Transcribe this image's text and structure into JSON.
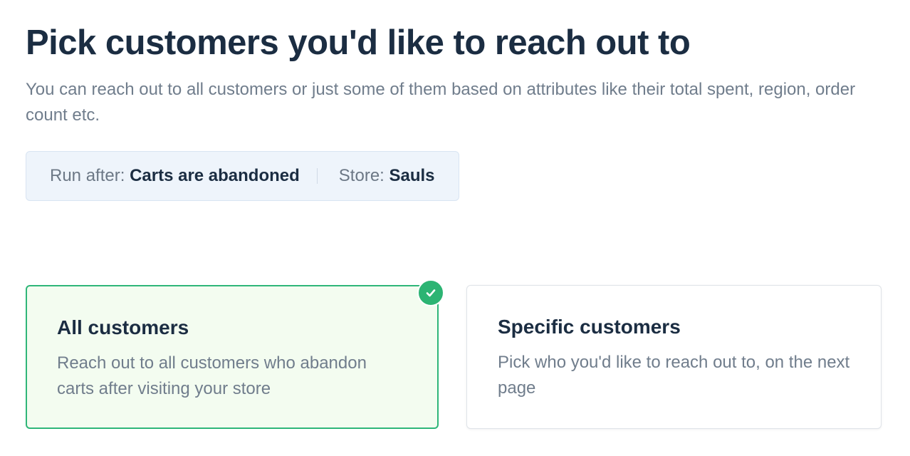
{
  "header": {
    "title": "Pick customers you'd like to reach out to",
    "subtitle": "You can reach out to all customers or just some of them based on attributes like their total spent, region, order count etc."
  },
  "context": {
    "run_after_label": "Run after:",
    "run_after_value": "Carts are abandoned",
    "store_label": "Store:",
    "store_value": "Sauls"
  },
  "options": [
    {
      "title": "All customers",
      "description": "Reach out to all customers who abandon carts after visiting your store",
      "selected": true
    },
    {
      "title": "Specific customers",
      "description": "Pick who you'd like to reach out to, on the next page",
      "selected": false
    }
  ],
  "icons": {
    "selected": "check-icon"
  },
  "colors": {
    "accent_green": "#2cb473",
    "selected_card_bg": "#f3fcf0",
    "context_bg": "#eef4fb",
    "heading": "#1b2d42",
    "muted_text": "#707d8c"
  }
}
